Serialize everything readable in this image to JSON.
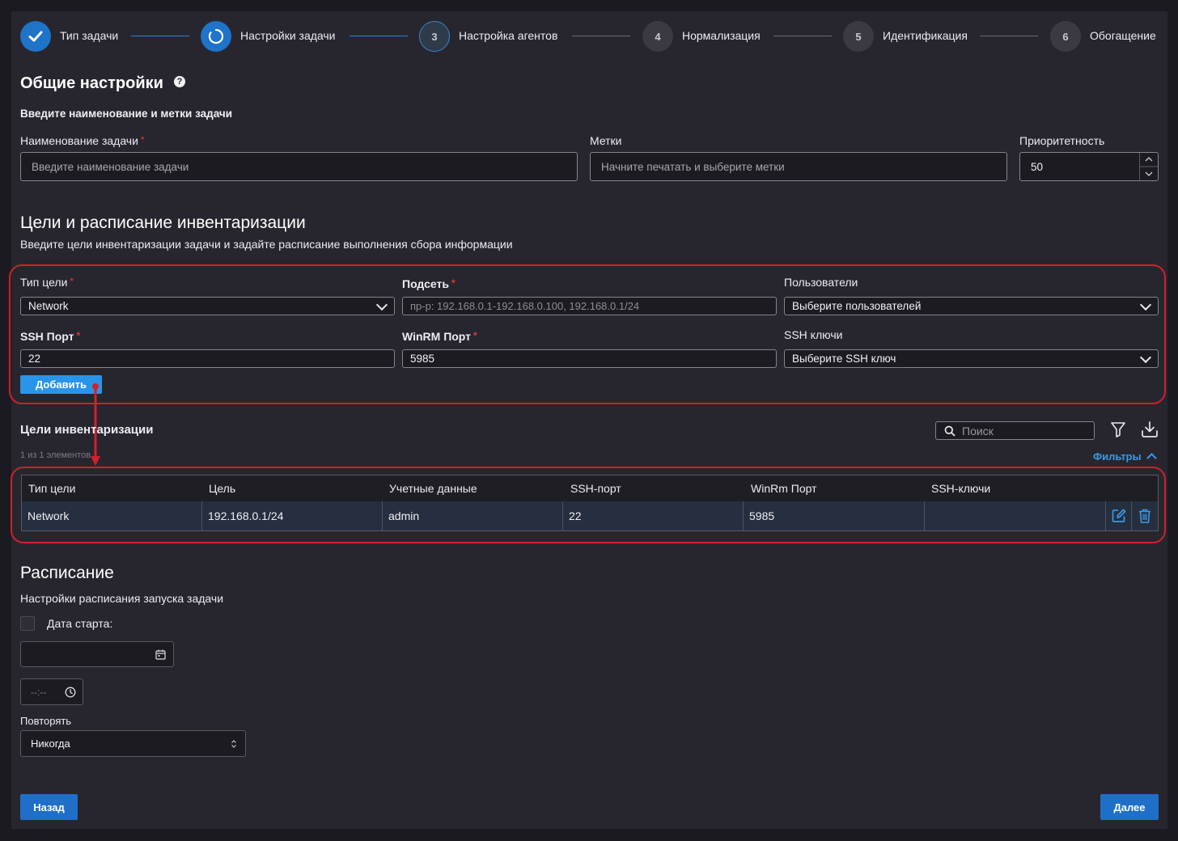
{
  "stepper": [
    {
      "num": "",
      "label": "Тип задачи"
    },
    {
      "num": "",
      "label": "Настройки задачи"
    },
    {
      "num": "3",
      "label": "Настройка агентов"
    },
    {
      "num": "4",
      "label": "Нормализация"
    },
    {
      "num": "5",
      "label": "Идентификация"
    },
    {
      "num": "6",
      "label": "Обогащение"
    }
  ],
  "general": {
    "title": "Общие настройки",
    "help_icon": "?",
    "subtitle": "Введите наименование и метки задачи",
    "name_label": "Наименование задачи",
    "name_placeholder": "Введите наименование задачи",
    "tags_label": "Метки",
    "tags_placeholder": "Начните печатать и выберите метки",
    "priority_label": "Приоритетность",
    "priority_value": "50"
  },
  "targets": {
    "title": "Цели и расписание инвентаризации",
    "subtitle": "Введите цели инвентаризации задачи и задайте расписание выполнения сбора информации",
    "target_type_label": "Тип цели",
    "target_type_value": "Network",
    "subnet_label": "Подсеть",
    "subnet_placeholder": "пр-р: 192.168.0.1-192.168.0.100, 192.168.0.1/24",
    "users_label": "Пользователи",
    "users_value": "Выберите пользователей",
    "ssh_port_label": "SSH Порт",
    "ssh_port_value": "22",
    "winrm_port_label": "WinRM Порт",
    "winrm_port_value": "5985",
    "ssh_keys_label": "SSH ключи",
    "ssh_keys_value": "Выберите SSH ключ",
    "add_button": "Добавить"
  },
  "inventory": {
    "title": "Цели инвентаризации",
    "search_placeholder": "Поиск",
    "count_text": "1 из 1 элементов",
    "filters_label": "Фильтры",
    "columns": [
      "Тип цели",
      "Цель",
      "Учетные данные",
      "SSH-порт",
      "WinRm Порт",
      "SSH-ключи"
    ],
    "rows": [
      [
        "Network",
        "192.168.0.1/24",
        "admin",
        "22",
        "5985",
        ""
      ]
    ]
  },
  "schedule": {
    "title": "Расписание",
    "subtitle": "Настройки расписания запуска задачи",
    "start_date_label": "Дата старта:",
    "time_placeholder": "--:--",
    "repeat_label": "Повторять",
    "repeat_value": "Никогда"
  },
  "footer": {
    "back_button": "Назад",
    "next_button": "Далее"
  },
  "colors": {
    "accent": "#1f6fc8",
    "highlight_border": "#d1202a",
    "required": "#e03a3a",
    "link": "#3a9ae6"
  }
}
